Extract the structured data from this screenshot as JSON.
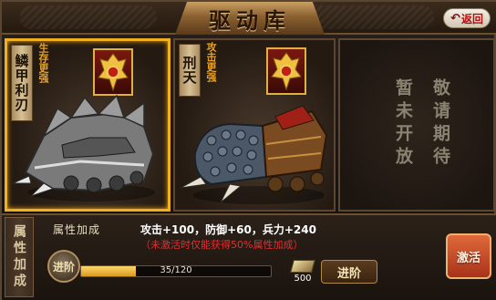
{
  "header": {
    "title": "驱动库",
    "back_label": "返回"
  },
  "cards": [
    {
      "name": "鳞甲利刃",
      "perk": "生存更强",
      "selected": true
    },
    {
      "name": "刑天",
      "perk": "攻击更强",
      "selected": false
    },
    {
      "locked_lines": [
        "敬请期待",
        "暂未开放"
      ]
    }
  ],
  "attributes": {
    "side_label": "属性加成",
    "title": "属性加成",
    "values": "攻击+100，防御+60，兵力+240",
    "note": "（未激活时仅能获得50%属性加成）"
  },
  "advance": {
    "icon_label": "进阶",
    "progress_text": "35/120",
    "progress_fraction": 0.29,
    "cost": "500",
    "button_label": "进阶"
  },
  "activate_label": "激活",
  "icons": {
    "back": "back-arrow-icon",
    "badge": "crest-icon",
    "cost": "ingot-icon",
    "advance": "advance-icon"
  }
}
